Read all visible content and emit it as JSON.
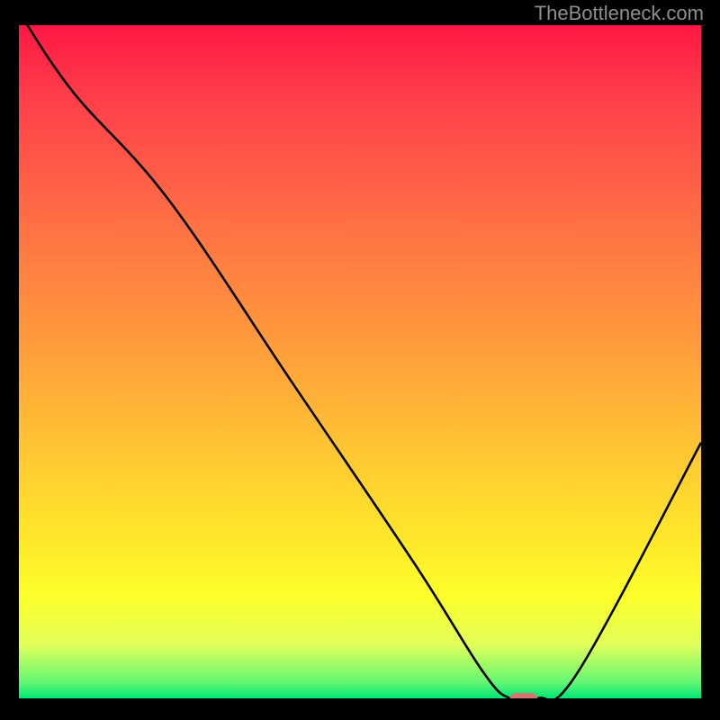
{
  "watermark": "TheBottleneck.com",
  "chart_data": {
    "type": "line",
    "title": "",
    "xlabel": "",
    "ylabel": "",
    "xlim": [
      0,
      100
    ],
    "ylim": [
      0,
      100
    ],
    "x": [
      0,
      8,
      22,
      40,
      58,
      68,
      72,
      76,
      82,
      100
    ],
    "values": [
      102,
      90,
      74,
      47,
      20,
      4,
      0,
      0,
      4,
      38
    ],
    "marker": {
      "x_start": 72,
      "x_end": 76,
      "y": 0
    },
    "colors": {
      "curve": "#000000",
      "marker": "#d2766f",
      "gradient_top": "#ff1744",
      "gradient_bottom": "#00e676"
    }
  }
}
